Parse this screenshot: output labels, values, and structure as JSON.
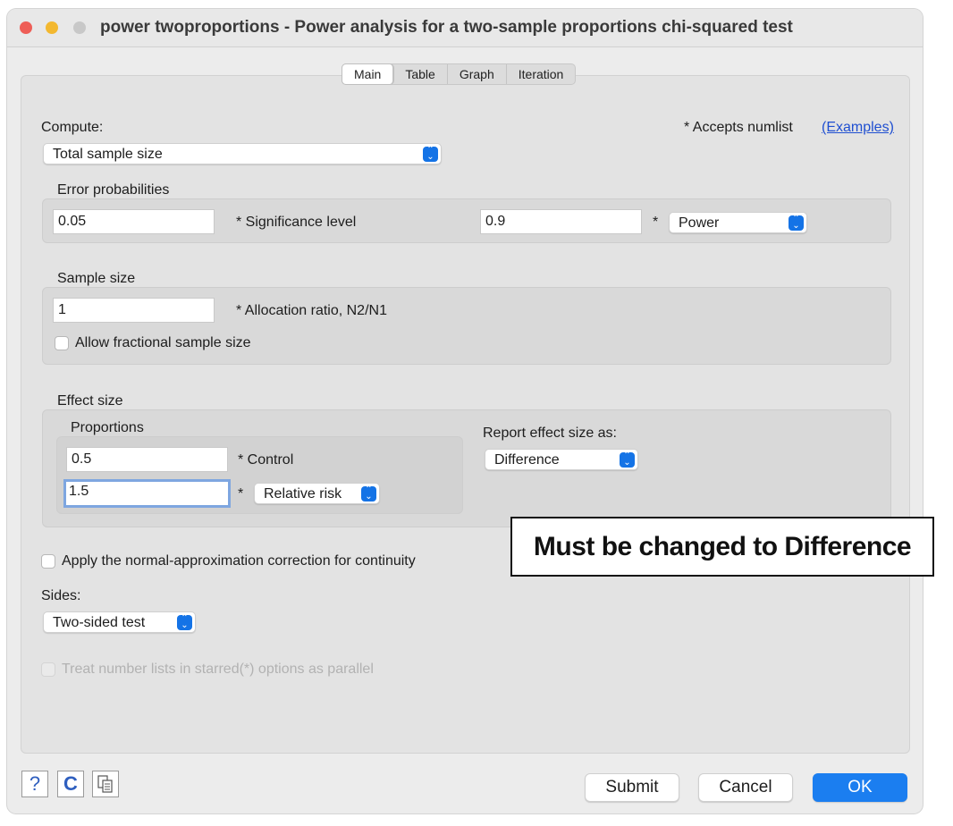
{
  "window": {
    "title": "power twoproportions - Power analysis for a two-sample proportions chi-squared test"
  },
  "tabs": [
    "Main",
    "Table",
    "Graph",
    "Iteration"
  ],
  "compute": {
    "label": "Compute:",
    "value": "Total sample size"
  },
  "numlist": {
    "note": "* Accepts numlist",
    "link": "(Examples)"
  },
  "error": {
    "title": "Error probabilities",
    "alpha_value": "0.05",
    "alpha_label": "* Significance level",
    "power_value": "0.9",
    "power_star": "*",
    "power_select": "Power"
  },
  "sample": {
    "title": "Sample size",
    "ratio_value": "1",
    "ratio_label": "* Allocation ratio, N2/N1",
    "fractional_label": "Allow fractional sample size"
  },
  "effect": {
    "title": "Effect size",
    "proportions_title": "Proportions",
    "control_value": "0.5",
    "control_label": "* Control",
    "second_value": "1.5",
    "second_star": "*",
    "second_select": "Relative risk",
    "report_label": "Report effect size as:",
    "report_value": "Difference"
  },
  "continuity_label": "Apply the normal-approximation correction for continuity",
  "sides": {
    "label": "Sides:",
    "value": "Two-sided test"
  },
  "parallel_label": "Treat number lists in starred(*) options as parallel",
  "annotation": "Must be changed to Difference",
  "buttons": {
    "submit": "Submit",
    "cancel": "Cancel",
    "ok": "OK"
  },
  "icons": {
    "help": "?",
    "reset": "C"
  }
}
